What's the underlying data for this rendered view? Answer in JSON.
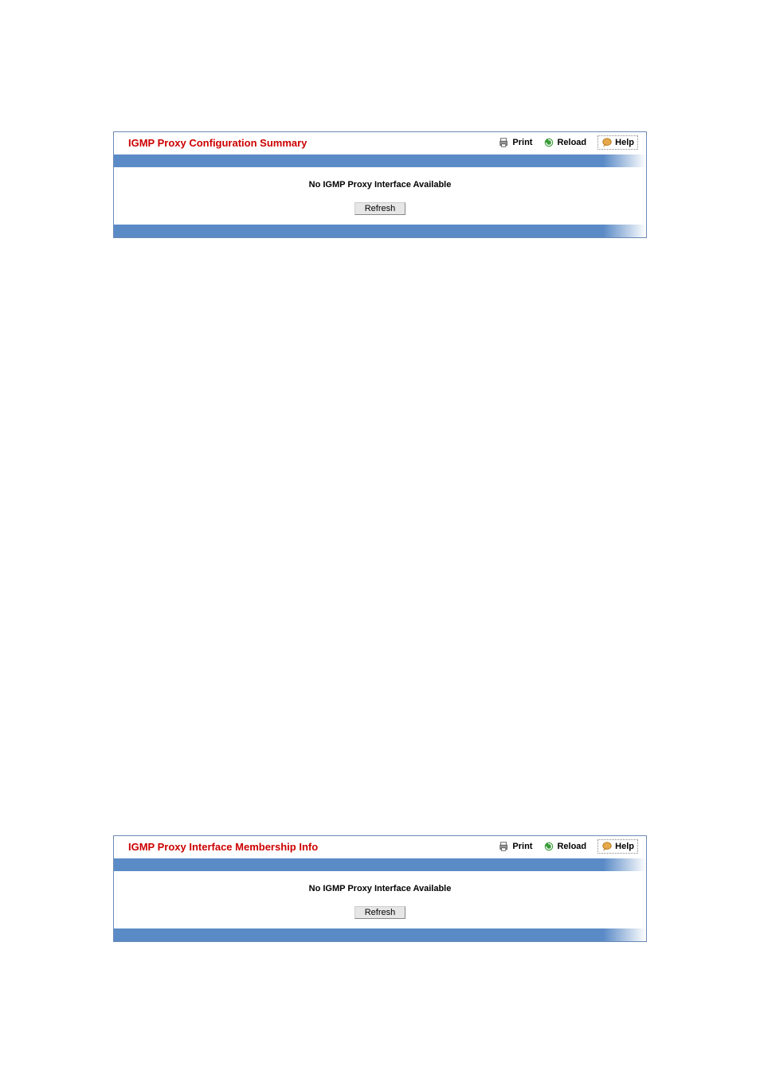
{
  "panels": [
    {
      "title": "IGMP Proxy Configuration Summary",
      "toolbar": {
        "print": "Print",
        "reload": "Reload",
        "help": "Help"
      },
      "status": "No IGMP Proxy Interface Available",
      "refresh_label": "Refresh"
    },
    {
      "title": "IGMP Proxy Interface Membership Info",
      "toolbar": {
        "print": "Print",
        "reload": "Reload",
        "help": "Help"
      },
      "status": "No IGMP Proxy Interface Available",
      "refresh_label": "Refresh"
    }
  ]
}
